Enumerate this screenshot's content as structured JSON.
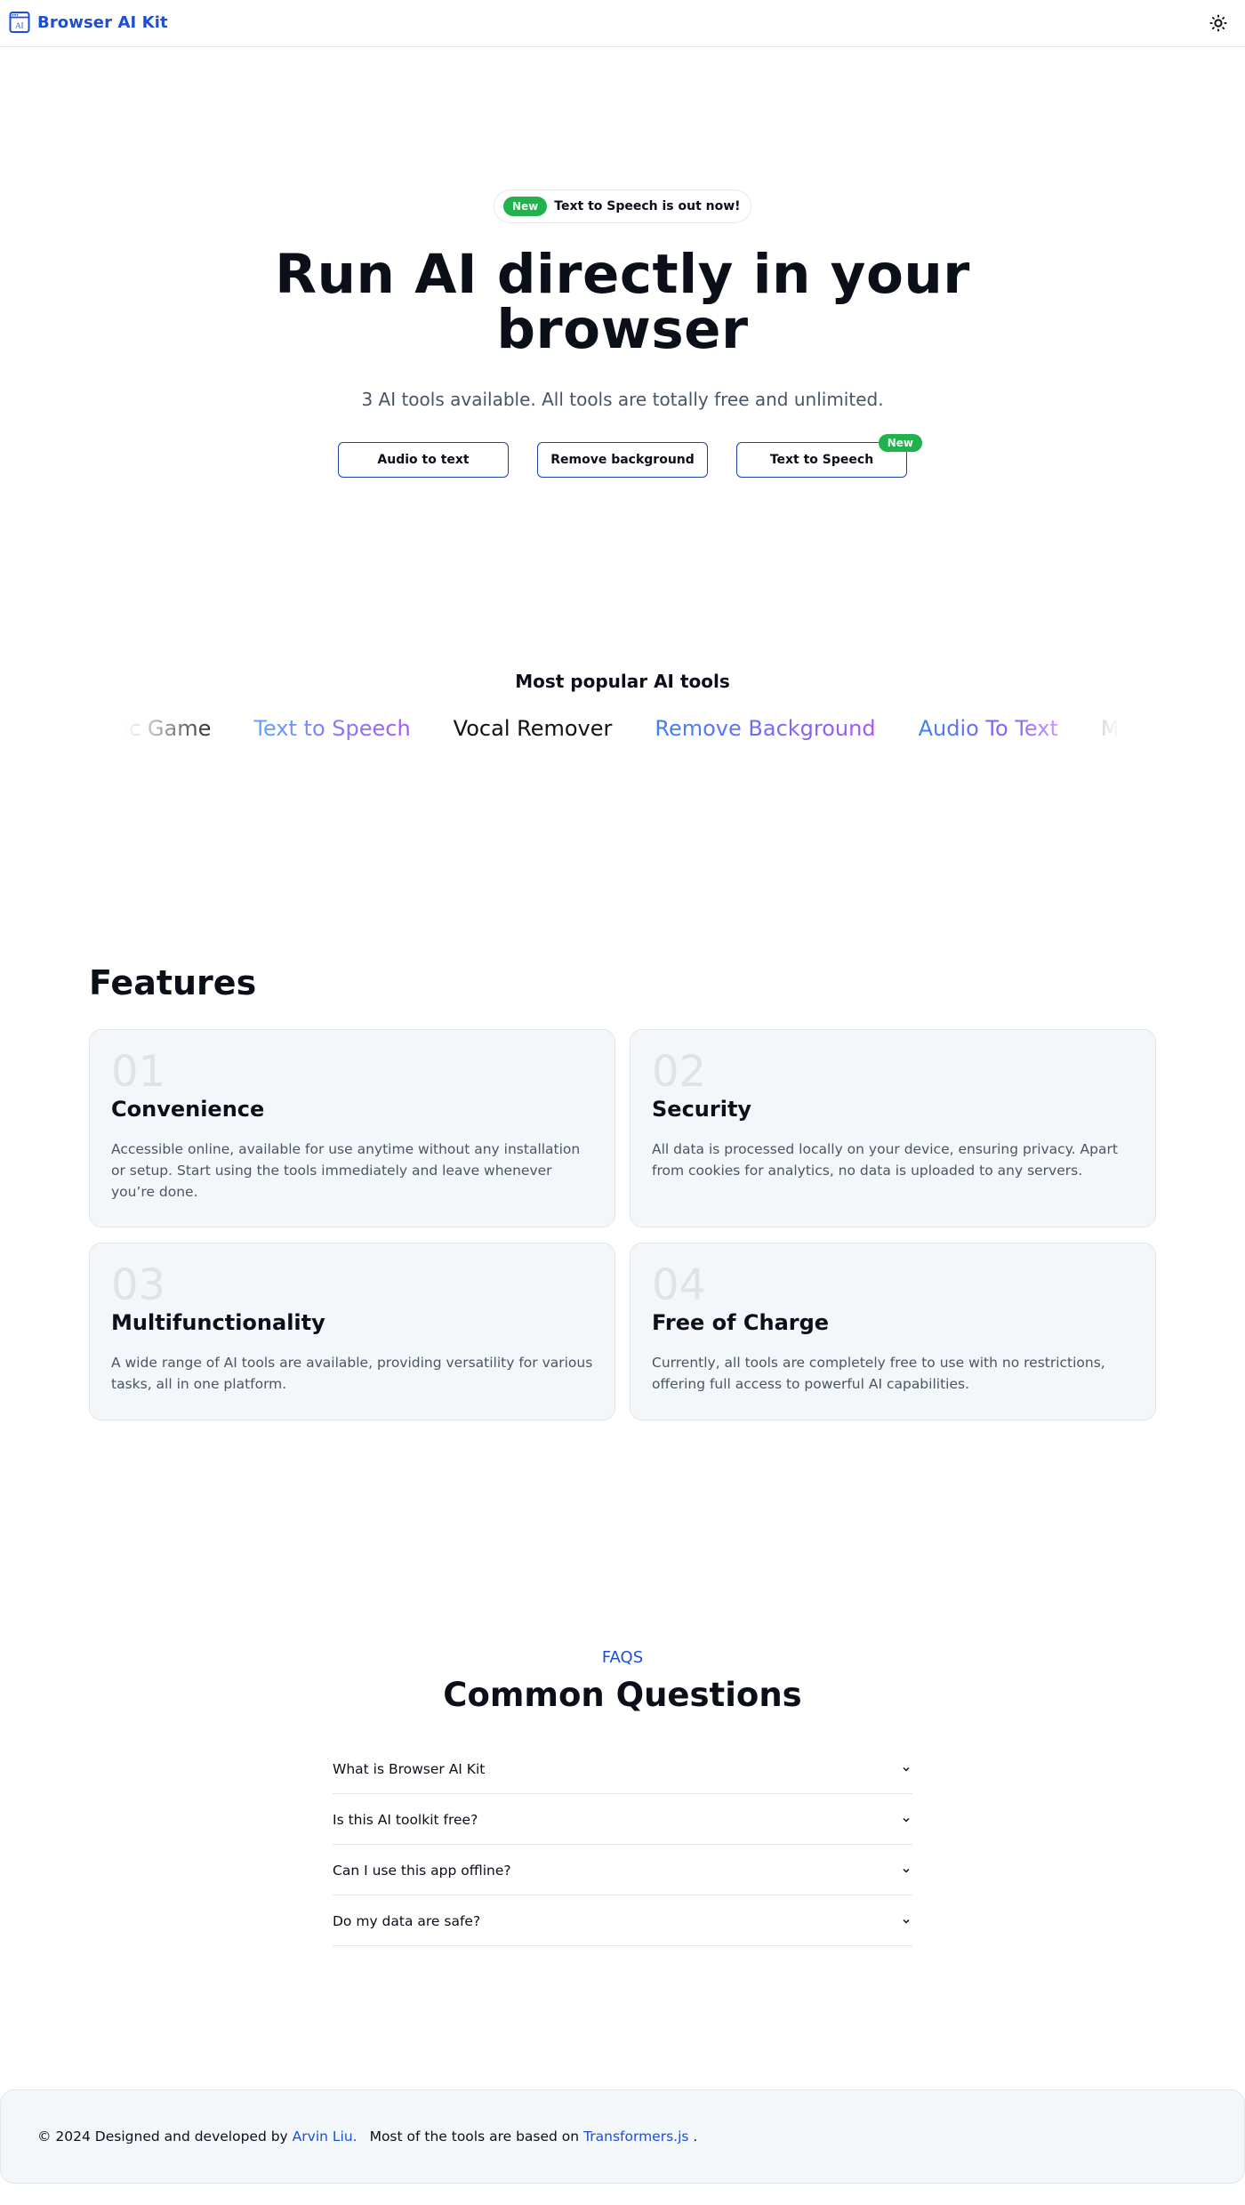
{
  "header": {
    "brand": "Browser AI Kit",
    "brand_icon": "ai-window-icon",
    "theme_toggle_icon": "sun-icon"
  },
  "hero": {
    "announcement": {
      "badge": "New",
      "text": "Text to Speech is out now!"
    },
    "title": "Run AI directly in your browser",
    "subtitle": "3 AI tools available. All tools are totally free and unlimited.",
    "buttons": [
      {
        "label": "Audio to text",
        "badge": null
      },
      {
        "label": "Remove background",
        "badge": null
      },
      {
        "label": "Text to Speech",
        "badge": "New"
      }
    ]
  },
  "popular": {
    "title": "Most popular AI tools",
    "items": [
      {
        "label": "Music Game",
        "style": "plain"
      },
      {
        "label": "Text to Speech",
        "style": "gradient"
      },
      {
        "label": "Vocal Remover",
        "style": "plain"
      },
      {
        "label": "Remove Background",
        "style": "gradient"
      },
      {
        "label": "Audio To Text",
        "style": "gradient"
      },
      {
        "label": "Music Game",
        "style": "plain"
      }
    ]
  },
  "features": {
    "title": "Features",
    "items": [
      {
        "num": "01",
        "title": "Convenience",
        "desc": "Accessible online, available for use anytime without any installation or setup. Start using the tools immediately and leave whenever you’re done."
      },
      {
        "num": "02",
        "title": "Security",
        "desc": "All data is processed locally on your device, ensuring privacy. Apart from cookies for analytics, no data is uploaded to any servers."
      },
      {
        "num": "03",
        "title": "Multifunctionality",
        "desc": "A wide range of AI tools are available, providing versatility for various tasks, all in one platform."
      },
      {
        "num": "04",
        "title": "Free of Charge",
        "desc": "Currently, all tools are completely free to use with no restrictions, offering full access to powerful AI capabilities."
      }
    ]
  },
  "faq": {
    "label": "FAQS",
    "title": "Common Questions",
    "items": [
      {
        "question": "What is Browser AI Kit"
      },
      {
        "question": "Is this AI toolkit free?"
      },
      {
        "question": "Can I use this app offline?"
      },
      {
        "question": "Do my data are safe?"
      }
    ]
  },
  "footer": {
    "copyright": "© 2024 Designed and developed by",
    "author": "Arvin Liu.",
    "based_on": "Most of the tools are based on",
    "library": "Transformers.js",
    "end": "."
  },
  "colors": {
    "brand": "#1d4ed8",
    "badge_green": "#22b14c",
    "card_bg": "#f4f7f9",
    "gradient_start": "#3b82f6",
    "gradient_end": "#a855f7"
  }
}
